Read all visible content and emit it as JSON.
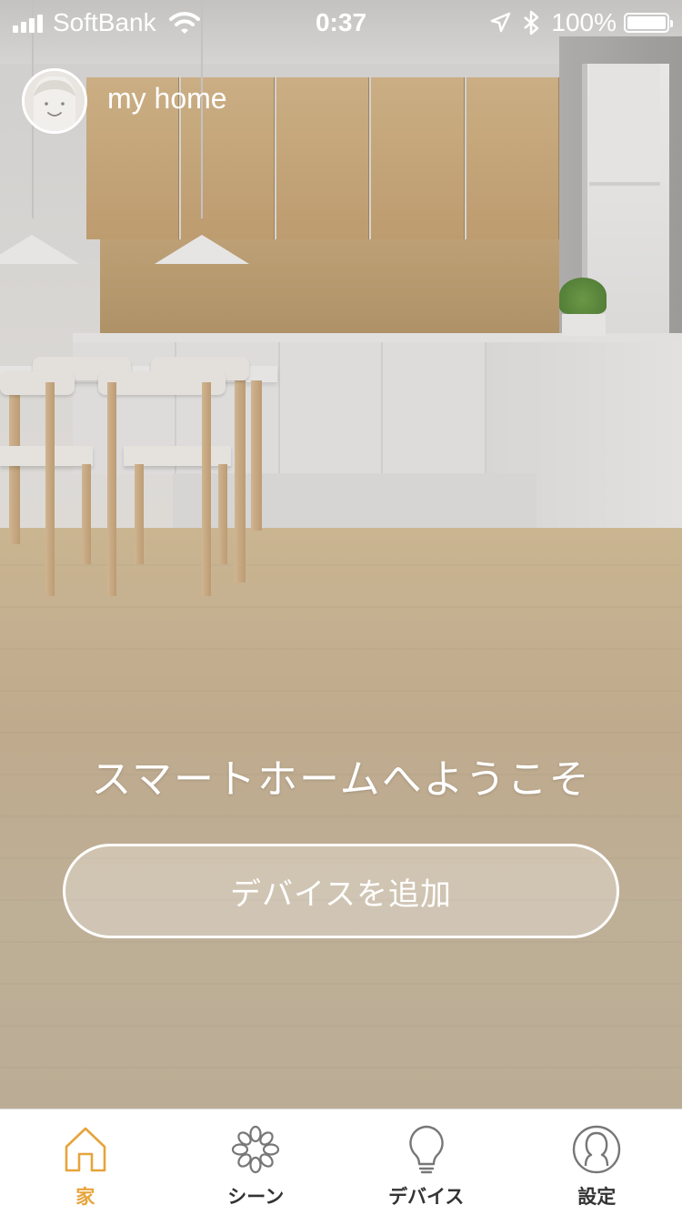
{
  "status_bar": {
    "carrier": "SoftBank",
    "time": "0:37",
    "battery_percent": "100%",
    "battery_level": 1.0
  },
  "header": {
    "home_name": "my home"
  },
  "main": {
    "welcome_text": "スマートホームへようこそ",
    "add_device_label": "デバイスを追加"
  },
  "tab_bar": {
    "accent_color": "#e6a43b",
    "inactive_color": "#333333",
    "tabs": [
      {
        "label": "家",
        "icon": "home-icon",
        "active": true
      },
      {
        "label": "シーン",
        "icon": "scene-icon",
        "active": false
      },
      {
        "label": "デバイス",
        "icon": "bulb-icon",
        "active": false
      },
      {
        "label": "設定",
        "icon": "profile-icon",
        "active": false
      }
    ]
  }
}
